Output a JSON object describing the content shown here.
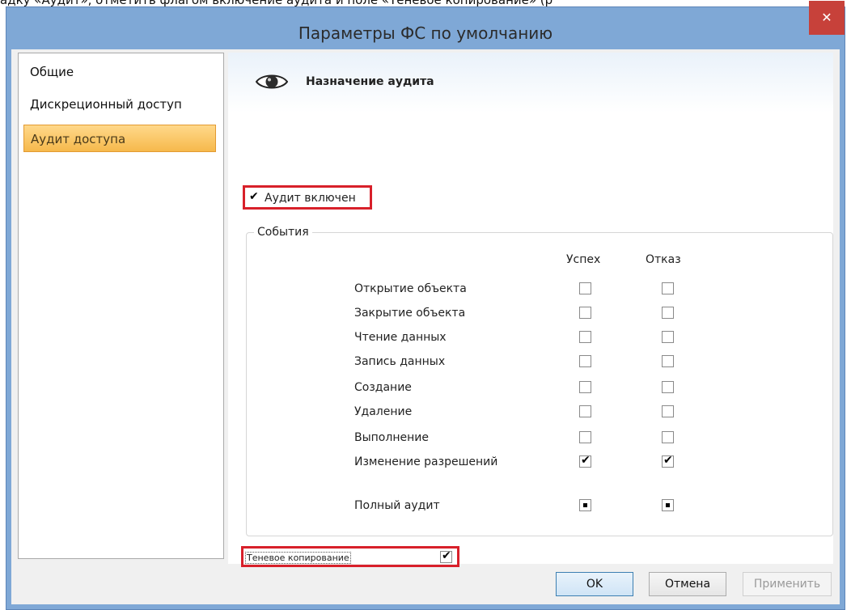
{
  "background_text": "адку «Аудит», отметить флагом включение аудита и поле «Теневое копирование» (р",
  "window": {
    "title": "Параметры ФС по умолчанию",
    "close_glyph": "✕"
  },
  "nav": {
    "items": [
      {
        "label": "Общие",
        "selected": false
      },
      {
        "label": "Дискреционный доступ",
        "selected": false
      },
      {
        "label": "Аудит доступа",
        "selected": true
      }
    ]
  },
  "header": {
    "title": "Назначение аудита",
    "icon": "eye-icon"
  },
  "audit_enabled": {
    "label": "Аудит включен",
    "checked": true
  },
  "events": {
    "legend": "События",
    "col_success": "Успех",
    "col_failure": "Отказ",
    "rows": [
      {
        "label": "Открытие объекта",
        "success": false,
        "failure": false
      },
      {
        "label": "Закрытие объекта",
        "success": false,
        "failure": false
      },
      {
        "label": "Чтение данных",
        "success": false,
        "failure": false
      },
      {
        "label": "Запись данных",
        "success": false,
        "failure": false
      },
      {
        "label": "Создание",
        "success": false,
        "failure": false
      },
      {
        "label": "Удаление",
        "success": false,
        "failure": false
      },
      {
        "label": "Выполнение",
        "success": false,
        "failure": false
      },
      {
        "label": "Изменение разрешений",
        "success": true,
        "failure": true
      }
    ],
    "full_audit": {
      "label": "Полный аудит",
      "success": "partial",
      "failure": "partial"
    }
  },
  "shadow_copy": {
    "label": "Теневое копирование",
    "checked": true
  },
  "buttons": {
    "ok": "OK",
    "cancel": "Отмена",
    "apply": "Применить"
  },
  "colors": {
    "highlight_border": "#d8202a",
    "selected_nav": "#f6b94c",
    "close": "#c7413a"
  }
}
